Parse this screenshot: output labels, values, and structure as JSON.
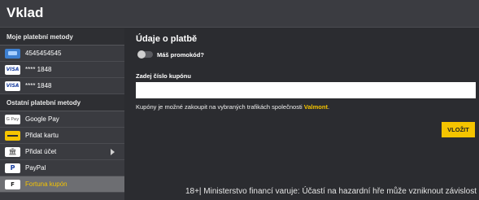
{
  "header": {
    "title": "Vklad"
  },
  "sidebar": {
    "my_methods_title": "Moje platební metody",
    "my_methods": [
      {
        "label": "4545454545",
        "icon": "card-icon"
      },
      {
        "label": "**** 1848",
        "icon": "visa-icon",
        "icon_text": "VISA"
      },
      {
        "label": "**** 1848",
        "icon": "visa-icon",
        "icon_text": "VISA"
      }
    ],
    "other_methods_title": "Ostatní platební metody",
    "other_methods": [
      {
        "label": "Google Pay",
        "icon": "google-pay-icon",
        "icon_text": "G Pay"
      },
      {
        "label": "Přidat kartu",
        "icon": "add-card-icon"
      },
      {
        "label": "Přidat účet",
        "icon": "bank-icon",
        "icon_text": "🏛"
      },
      {
        "label": "PayPal",
        "icon": "paypal-icon",
        "icon_text": "P"
      },
      {
        "label": "Fortuna kupón",
        "icon": "fortuna-coupon-icon",
        "icon_text": "F",
        "active": true
      }
    ]
  },
  "main": {
    "heading": "Údaje o platbě",
    "promo_toggle_label": "Máš promokód?",
    "coupon_label": "Zadej číslo kupónu",
    "coupon_value": "",
    "info_text": "Kupóny je možné zakoupit na vybraných trafikách společnosti ",
    "info_brand": "Valmont",
    "info_end": ".",
    "deposit_button": "VLOŽIT"
  },
  "footer": {
    "text": "18+| Ministerstvo financí varuje: Účastí na hazardní hře může vzniknout závislost"
  },
  "colors": {
    "accent": "#f5c400",
    "background": "#2b2c30",
    "sidebar": "#3a3b40",
    "active_item": "#6d6e72"
  }
}
